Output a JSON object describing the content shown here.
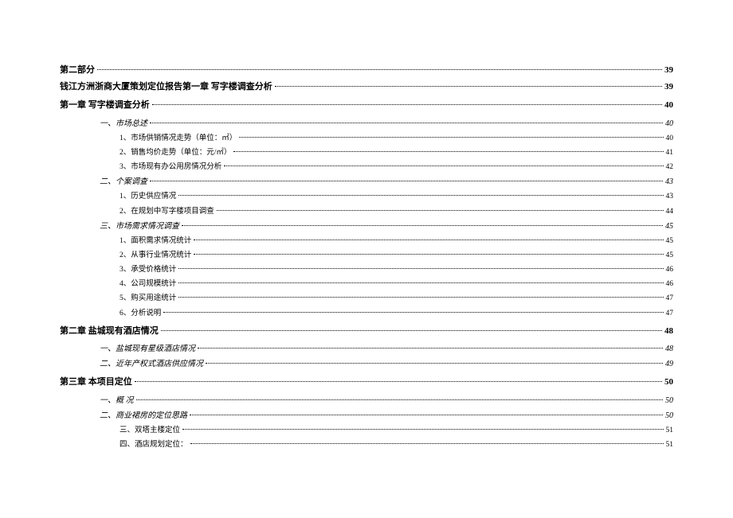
{
  "toc": [
    {
      "title": "第二部分",
      "page": "39",
      "level": 0,
      "bold": true,
      "italic": false,
      "indent": 0,
      "gap": false
    },
    {
      "title": "钱江方洲浙商大厦策划定位报告第一章   写字楼调查分析",
      "page": "39",
      "level": 0,
      "bold": true,
      "italic": false,
      "indent": 0,
      "gap": false
    },
    {
      "title": "第一章   写字楼调查分析",
      "page": "40",
      "level": 1,
      "bold": true,
      "italic": false,
      "indent": 0,
      "gap": true
    },
    {
      "title": "一、市场总述",
      "page": "40",
      "level": 2,
      "bold": false,
      "italic": true,
      "indent": 1,
      "gap": true
    },
    {
      "title": "1、市场供销情况走势（单位：㎡）",
      "page": "40",
      "level": 3,
      "bold": false,
      "italic": false,
      "indent": 2,
      "gap": false
    },
    {
      "title": "2、销售均价走势（单位：元/㎡）",
      "page": "41",
      "level": 3,
      "bold": false,
      "italic": false,
      "indent": 2,
      "gap": false
    },
    {
      "title": "3、市场现有办公用房情况分析",
      "page": "42",
      "level": 3,
      "bold": false,
      "italic": false,
      "indent": 2,
      "gap": false
    },
    {
      "title": "二、个案调查",
      "page": "43",
      "level": 2,
      "bold": false,
      "italic": true,
      "indent": 1,
      "gap": false
    },
    {
      "title": "1、历史供应情况",
      "page": "43",
      "level": 3,
      "bold": false,
      "italic": false,
      "indent": 2,
      "gap": false
    },
    {
      "title": "2、在规划中写字楼项目调查",
      "page": "44",
      "level": 3,
      "bold": false,
      "italic": false,
      "indent": 2,
      "gap": false
    },
    {
      "title": "三、市场需求情况调查",
      "page": "45",
      "level": 2,
      "bold": false,
      "italic": true,
      "indent": 1,
      "gap": false
    },
    {
      "title": "1、面积需求情况统计",
      "page": "45",
      "level": 3,
      "bold": false,
      "italic": false,
      "indent": 2,
      "gap": false
    },
    {
      "title": "2、从事行业情况统计",
      "page": "45",
      "level": 3,
      "bold": false,
      "italic": false,
      "indent": 2,
      "gap": false
    },
    {
      "title": "3、承受价格统计",
      "page": "46",
      "level": 3,
      "bold": false,
      "italic": false,
      "indent": 2,
      "gap": false
    },
    {
      "title": "4、公司规模统计",
      "page": "46",
      "level": 3,
      "bold": false,
      "italic": false,
      "indent": 2,
      "gap": false
    },
    {
      "title": "5、购买用途统计",
      "page": "47",
      "level": 3,
      "bold": false,
      "italic": false,
      "indent": 2,
      "gap": false
    },
    {
      "title": "6、分析说明",
      "page": "47",
      "level": 3,
      "bold": false,
      "italic": false,
      "indent": 2,
      "gap": false
    },
    {
      "title": "第二章   盐城现有酒店情况",
      "page": "48",
      "level": 1,
      "bold": true,
      "italic": false,
      "indent": 0,
      "gap": true
    },
    {
      "title": "一、盐城现有星级酒店情况",
      "page": "48",
      "level": 2,
      "bold": false,
      "italic": true,
      "indent": 1,
      "gap": true
    },
    {
      "title": "二、近年产权式酒店供应情况",
      "page": "49",
      "level": 2,
      "bold": false,
      "italic": true,
      "indent": 1,
      "gap": false
    },
    {
      "title": "第三章   本项目定位",
      "page": "50",
      "level": 1,
      "bold": true,
      "italic": false,
      "indent": 0,
      "gap": true
    },
    {
      "title": "一、概  况",
      "page": "50",
      "level": 2,
      "bold": false,
      "italic": true,
      "indent": 1,
      "gap": true
    },
    {
      "title": "二、商业裙房的定位思路",
      "page": "50",
      "level": 2,
      "bold": false,
      "italic": true,
      "indent": 1,
      "gap": false
    },
    {
      "title": "三、双塔主楼定位",
      "page": "51",
      "level": 3,
      "bold": false,
      "italic": false,
      "indent": 2,
      "gap": false
    },
    {
      "title": "四、酒店规划定位：",
      "page": "51",
      "level": 3,
      "bold": false,
      "italic": false,
      "indent": 2,
      "gap": false
    }
  ]
}
